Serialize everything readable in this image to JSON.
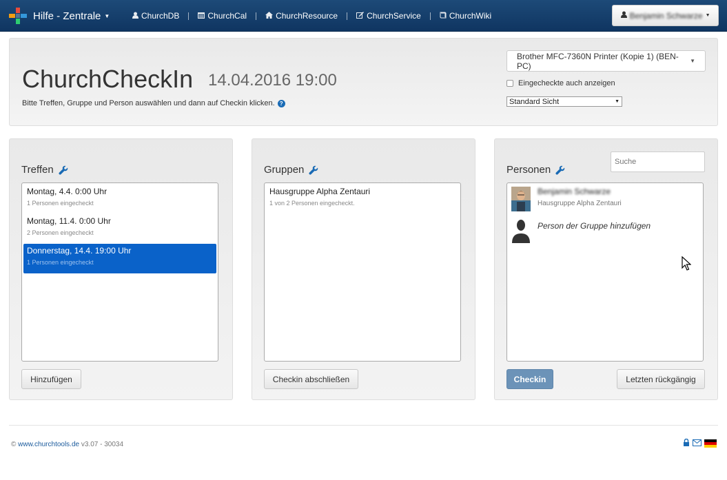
{
  "navbar": {
    "brand": "Hilfe - Zentrale",
    "items": [
      {
        "label": "ChurchDB",
        "icon": "user-icon"
      },
      {
        "label": "ChurchCal",
        "icon": "calendar-icon"
      },
      {
        "label": "ChurchResource",
        "icon": "home-icon"
      },
      {
        "label": "ChurchService",
        "icon": "edit-icon"
      },
      {
        "label": "ChurchWiki",
        "icon": "book-icon"
      }
    ],
    "user_name": "Benjamin Schwarze"
  },
  "header": {
    "title": "ChurchCheckIn",
    "date": "14.04.2016 19:00",
    "instructions": "Bitte Treffen, Gruppe und Person auswählen und dann auf Checkin klicken.",
    "printer": "Brother MFC-7360N Printer (Kopie 1) (BEN-PC)",
    "show_checked_label": "Eingecheckte auch anzeigen",
    "view": "Standard Sicht"
  },
  "treffen": {
    "title": "Treffen",
    "items": [
      {
        "label": "Montag, 4.4. 0:00 Uhr",
        "sub": "1 Personen eingecheckt"
      },
      {
        "label": "Montag, 11.4. 0:00 Uhr",
        "sub": "2 Personen eingecheckt"
      },
      {
        "label": "Donnerstag, 14.4. 19:00 Uhr",
        "sub": "1 Personen eingecheckt"
      }
    ],
    "button": "Hinzufügen"
  },
  "gruppen": {
    "title": "Gruppen",
    "items": [
      {
        "label": "Hausgruppe Alpha Zentauri",
        "sub": "1 von 2 Personen eingecheckt."
      }
    ],
    "button": "Checkin abschließen"
  },
  "personen": {
    "title": "Personen",
    "search_placeholder": "Suche",
    "items": [
      {
        "name": "Benjamin Schwarze",
        "group": "Hausgruppe Alpha Zentauri"
      }
    ],
    "add_label": "Person der Gruppe hinzufügen",
    "checkin_button": "Checkin",
    "undo_button": "Letzten rückgängig"
  },
  "footer": {
    "copyright": "©",
    "link": "www.churchtools.de",
    "version": "v3.07 - 30034"
  },
  "colors": {
    "navbar": "#0f3561",
    "selected": "#0a62c9",
    "primary_button": "#6c93b8",
    "link": "#1a6bb5"
  }
}
